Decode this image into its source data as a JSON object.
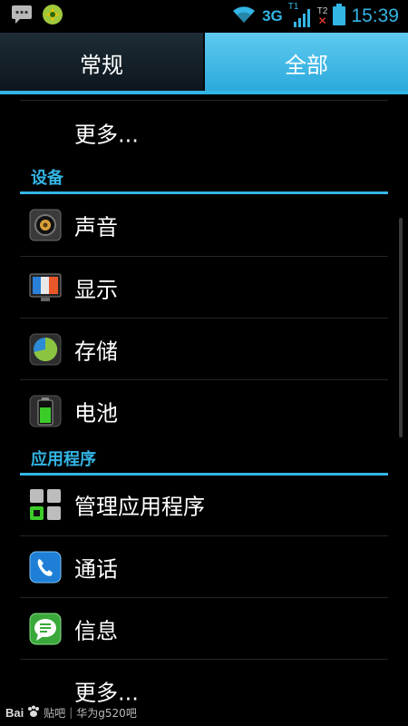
{
  "status_bar": {
    "network": "3G",
    "sim1": "T1",
    "sim2": "T2",
    "time": "15:39",
    "icons": [
      "message-icon",
      "store-icon",
      "wifi-icon",
      "signal-icon",
      "no-signal-icon",
      "battery-icon"
    ],
    "accent": "#33b5e5"
  },
  "tabs": [
    {
      "label": "常规",
      "selected": false
    },
    {
      "label": "全部",
      "selected": true
    }
  ],
  "list": {
    "more_top": "更多...",
    "device_header": "设备",
    "device_items": [
      {
        "label": "声音",
        "icon": "sound-icon"
      },
      {
        "label": "显示",
        "icon": "display-icon"
      },
      {
        "label": "存储",
        "icon": "storage-icon"
      },
      {
        "label": "电池",
        "icon": "battery-settings-icon"
      }
    ],
    "apps_header": "应用程序",
    "apps_items": [
      {
        "label": "管理应用程序",
        "icon": "manage-apps-icon"
      },
      {
        "label": "通话",
        "icon": "phone-icon"
      },
      {
        "label": "信息",
        "icon": "messaging-icon"
      }
    ],
    "more_bottom": "更多..."
  },
  "watermark": {
    "logo": "Bai",
    "logo_suffix": "贴吧",
    "text": "华为g520吧"
  }
}
